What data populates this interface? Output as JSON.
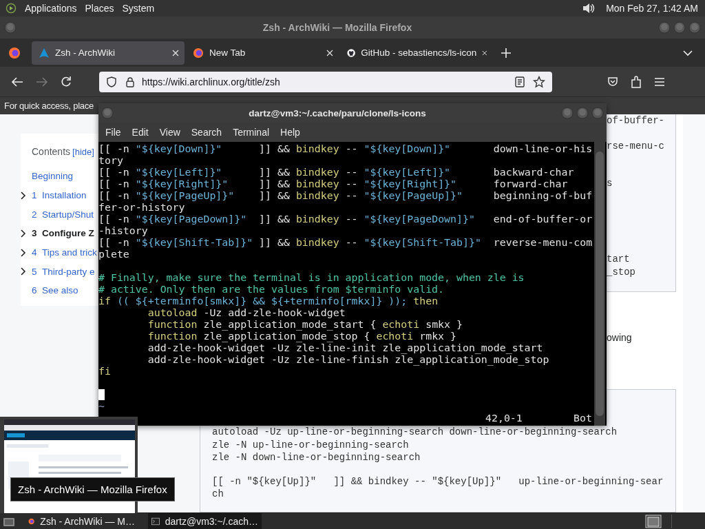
{
  "top_panel": {
    "menus": [
      "Applications",
      "Places",
      "System"
    ],
    "clock": "Mon Feb 27, 1:42 AM"
  },
  "browser": {
    "title": "Zsh - ArchWiki — Mozilla Firefox",
    "tabs": [
      {
        "title": "Zsh - ArchWiki",
        "selected": true
      },
      {
        "title": "New Tab",
        "selected": false
      },
      {
        "title": "GitHub - sebastiencs/ls-icon",
        "selected": false
      }
    ],
    "url": "https://wiki.archlinux.org/title/zsh",
    "bookmarks_hint": "For quick access, place",
    "toc": {
      "title": "Contents",
      "hide_link": "[hide]",
      "items": [
        {
          "label": "Beginning",
          "expandable": false,
          "selected": false
        },
        {
          "number": "1",
          "label": "Installation",
          "expandable": true,
          "selected": false
        },
        {
          "number": "2",
          "label": "Startup/Shut",
          "expandable": false,
          "selected": false
        },
        {
          "number": "3",
          "label": "Configure Z",
          "expandable": true,
          "selected": true
        },
        {
          "number": "4",
          "label": "Tips and trick",
          "expandable": true,
          "selected": false
        },
        {
          "number": "5",
          "label": "Third-party e",
          "expandable": true,
          "selected": false
        },
        {
          "number": "6",
          "label": "See also",
          "expandable": false,
          "selected": false
        }
      ]
    },
    "code_fragments": [
      "of-buffer-",
      "rse-menu-c",
      "s",
      "tart",
      "_stop"
    ],
    "text_fragment": "owing",
    "code_block": [
      [
        "autoload -Uz up-line-or-beginning-search down-line-or-beginning-search",
        "zle -N up-line-or-beginning-search",
        "zle -N down-line-or-beginning-search"
      ],
      [
        "[[ -n \"${key[Up]}\"   ]] && bindkey -- \"${key[Up]}\"   up-line-or-beginning-sear",
        "ch"
      ]
    ]
  },
  "terminal": {
    "title": "dartz@vm3:~/.cache/paru/clone/ls-icons",
    "menus": [
      "File",
      "Edit",
      "View",
      "Search",
      "Terminal",
      "Help"
    ],
    "rows": [
      {
        "kind": "code",
        "segments": [
          {
            "text": "[[ -n ",
            "kind": "plain"
          },
          {
            "text": "\"${key[Down]}\"",
            "kind": "str"
          },
          {
            "text": "      ]] && ",
            "kind": "plain"
          },
          {
            "text": "bindkey",
            "kind": "kw"
          },
          {
            "text": " -- ",
            "kind": "plain"
          },
          {
            "text": "\"${key[Down]}\"",
            "kind": "str"
          },
          {
            "text": "       down-line-or-his",
            "kind": "plain"
          }
        ]
      },
      {
        "kind": "code",
        "segments": [
          {
            "text": "tory",
            "kind": "plain"
          }
        ]
      },
      {
        "kind": "code",
        "segments": [
          {
            "text": "[[ -n ",
            "kind": "plain"
          },
          {
            "text": "\"${key[Left]}\"",
            "kind": "str"
          },
          {
            "text": "      ]] && ",
            "kind": "plain"
          },
          {
            "text": "bindkey",
            "kind": "kw"
          },
          {
            "text": " -- ",
            "kind": "plain"
          },
          {
            "text": "\"${key[Left]}\"",
            "kind": "str"
          },
          {
            "text": "       backward-char",
            "kind": "plain"
          }
        ]
      },
      {
        "kind": "code",
        "segments": [
          {
            "text": "[[ -n ",
            "kind": "plain"
          },
          {
            "text": "\"${key[Right]}\"",
            "kind": "str"
          },
          {
            "text": "     ]] && ",
            "kind": "plain"
          },
          {
            "text": "bindkey",
            "kind": "kw"
          },
          {
            "text": " -- ",
            "kind": "plain"
          },
          {
            "text": "\"${key[Right]}\"",
            "kind": "str"
          },
          {
            "text": "      forward-char",
            "kind": "plain"
          }
        ]
      },
      {
        "kind": "code",
        "segments": [
          {
            "text": "[[ -n ",
            "kind": "plain"
          },
          {
            "text": "\"${key[PageUp]}\"",
            "kind": "str"
          },
          {
            "text": "    ]] && ",
            "kind": "plain"
          },
          {
            "text": "bindkey",
            "kind": "kw"
          },
          {
            "text": " -- ",
            "kind": "plain"
          },
          {
            "text": "\"${key[PageUp]}\"",
            "kind": "str"
          },
          {
            "text": "     beginning-of-buf",
            "kind": "plain"
          }
        ]
      },
      {
        "kind": "code",
        "segments": [
          {
            "text": "fer-or-history",
            "kind": "plain"
          }
        ]
      },
      {
        "kind": "code",
        "segments": [
          {
            "text": "[[ -n ",
            "kind": "plain"
          },
          {
            "text": "\"${key[PageDown]}\"",
            "kind": "str"
          },
          {
            "text": "  ]] && ",
            "kind": "plain"
          },
          {
            "text": "bindkey",
            "kind": "kw"
          },
          {
            "text": " -- ",
            "kind": "plain"
          },
          {
            "text": "\"${key[PageDown]}\"",
            "kind": "str"
          },
          {
            "text": "   end-of-buffer-or",
            "kind": "plain"
          }
        ]
      },
      {
        "kind": "code",
        "segments": [
          {
            "text": "-history",
            "kind": "plain"
          }
        ]
      },
      {
        "kind": "code",
        "segments": [
          {
            "text": "[[ -n ",
            "kind": "plain"
          },
          {
            "text": "\"${key[Shift-Tab]}\"",
            "kind": "str"
          },
          {
            "text": " ]] && ",
            "kind": "plain"
          },
          {
            "text": "bindkey",
            "kind": "kw"
          },
          {
            "text": " -- ",
            "kind": "plain"
          },
          {
            "text": "\"${key[Shift-Tab]}\"",
            "kind": "str"
          },
          {
            "text": "  reverse-menu-com",
            "kind": "plain"
          }
        ]
      },
      {
        "kind": "code",
        "segments": [
          {
            "text": "plete",
            "kind": "plain"
          }
        ]
      },
      {
        "kind": "blank"
      },
      {
        "kind": "code",
        "segments": [
          {
            "text": "# Finally, make sure the terminal is in application mode, when zle is",
            "kind": "comment"
          }
        ]
      },
      {
        "kind": "code",
        "segments": [
          {
            "text": "# active. Only then are the values from $terminfo valid.",
            "kind": "comment"
          }
        ]
      },
      {
        "kind": "code",
        "segments": [
          {
            "text": "if",
            "kind": "kw"
          },
          {
            "text": " (( ${+terminfo[smkx]} && ${+terminfo[rmkx]} ));",
            "kind": "str"
          },
          {
            "text": " then",
            "kind": "kw"
          }
        ]
      },
      {
        "kind": "code",
        "segments": [
          {
            "text": "        autoload",
            "kind": "kw"
          },
          {
            "text": " -Uz add-zle-hook-widget",
            "kind": "plain"
          }
        ]
      },
      {
        "kind": "code",
        "segments": [
          {
            "text": "        function",
            "kind": "kw"
          },
          {
            "text": " zle_application_mode_start { ",
            "kind": "plain"
          },
          {
            "text": "echoti",
            "kind": "kw"
          },
          {
            "text": " smkx }",
            "kind": "plain"
          }
        ]
      },
      {
        "kind": "code",
        "segments": [
          {
            "text": "        function",
            "kind": "kw"
          },
          {
            "text": " zle_application_mode_stop { ",
            "kind": "plain"
          },
          {
            "text": "echoti",
            "kind": "kw"
          },
          {
            "text": " rmkx }",
            "kind": "plain"
          }
        ]
      },
      {
        "kind": "code",
        "segments": [
          {
            "text": "        add-zle-hook-widget -Uz zle-line-init zle_application_mode_start",
            "kind": "plain"
          }
        ]
      },
      {
        "kind": "code",
        "segments": [
          {
            "text": "        add-zle-hook-widget -Uz zle-line-finish zle_application_mode_stop",
            "kind": "plain"
          }
        ]
      },
      {
        "kind": "code",
        "segments": [
          {
            "text": "fi",
            "kind": "kw"
          }
        ]
      },
      {
        "kind": "blank"
      },
      {
        "kind": "cursor"
      },
      {
        "kind": "tilde",
        "text": "~"
      }
    ],
    "status": {
      "position": "42,0-1",
      "scroll": "Bot"
    }
  },
  "tooltip": "Zsh - ArchWiki — Mozilla Firefox",
  "taskbar": {
    "items": [
      {
        "title": "Zsh - ArchWiki — M…",
        "selected": false
      },
      {
        "title": "dartz@vm3:~/.cach…",
        "selected": true
      }
    ]
  }
}
